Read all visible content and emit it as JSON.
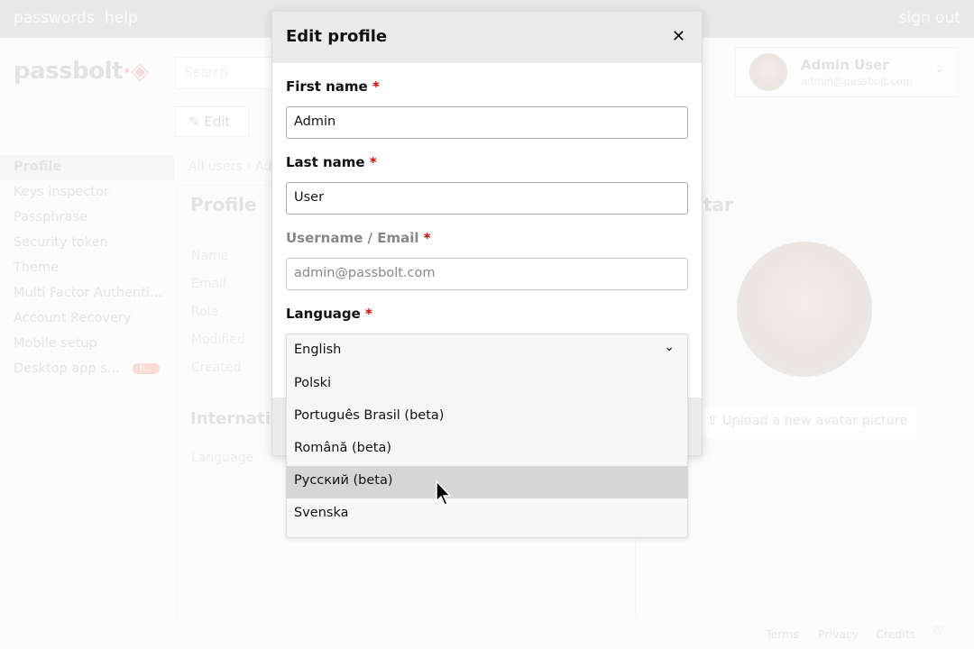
{
  "topbar": {
    "nav": [
      "passwords",
      "help"
    ],
    "sign_out": "sign out"
  },
  "brand": {
    "logo": "passbolt"
  },
  "search": {
    "placeholder": "Search"
  },
  "toolbar": {
    "edit": "Edit"
  },
  "breadcrumb": "All users › Adm",
  "sidebar": {
    "items": [
      {
        "label": "Profile",
        "active": true
      },
      {
        "label": "Keys inspector"
      },
      {
        "label": "Passphrase"
      },
      {
        "label": "Security token"
      },
      {
        "label": "Theme"
      },
      {
        "label": "Multi Factor Authenti..."
      },
      {
        "label": "Account Recovery"
      },
      {
        "label": "Mobile setup"
      },
      {
        "label": "Desktop app s...",
        "badge": "b..."
      }
    ]
  },
  "profile": {
    "title": "Profile",
    "fields": [
      "Name",
      "Email",
      "Role",
      "Modified",
      "Created"
    ],
    "intl_title": "Internatio",
    "intl_fields": [
      "Language"
    ]
  },
  "user": {
    "name": "Admin User",
    "email": "admin@passbolt.com"
  },
  "avatar": {
    "title": "tar",
    "upload": "Upload a new avatar picture"
  },
  "footer": {
    "links": [
      "Terms",
      "Privacy",
      "Credits"
    ]
  },
  "dialog": {
    "title": "Edit profile",
    "first_name": {
      "label": "First name",
      "value": "Admin"
    },
    "last_name": {
      "label": "Last name",
      "value": "User"
    },
    "email": {
      "label": "Username / Email",
      "value": "admin@passbolt.com"
    },
    "language": {
      "label": "Language",
      "value": "English",
      "options": [
        "Polski",
        "Português Brasil (beta)",
        "Română (beta)",
        "Русский (beta)",
        "Svenska"
      ],
      "highlighted": "Русский (beta)"
    },
    "required_mark": "*"
  },
  "colors": {
    "required": "#d40101",
    "highlight": "#d6d6d6"
  }
}
